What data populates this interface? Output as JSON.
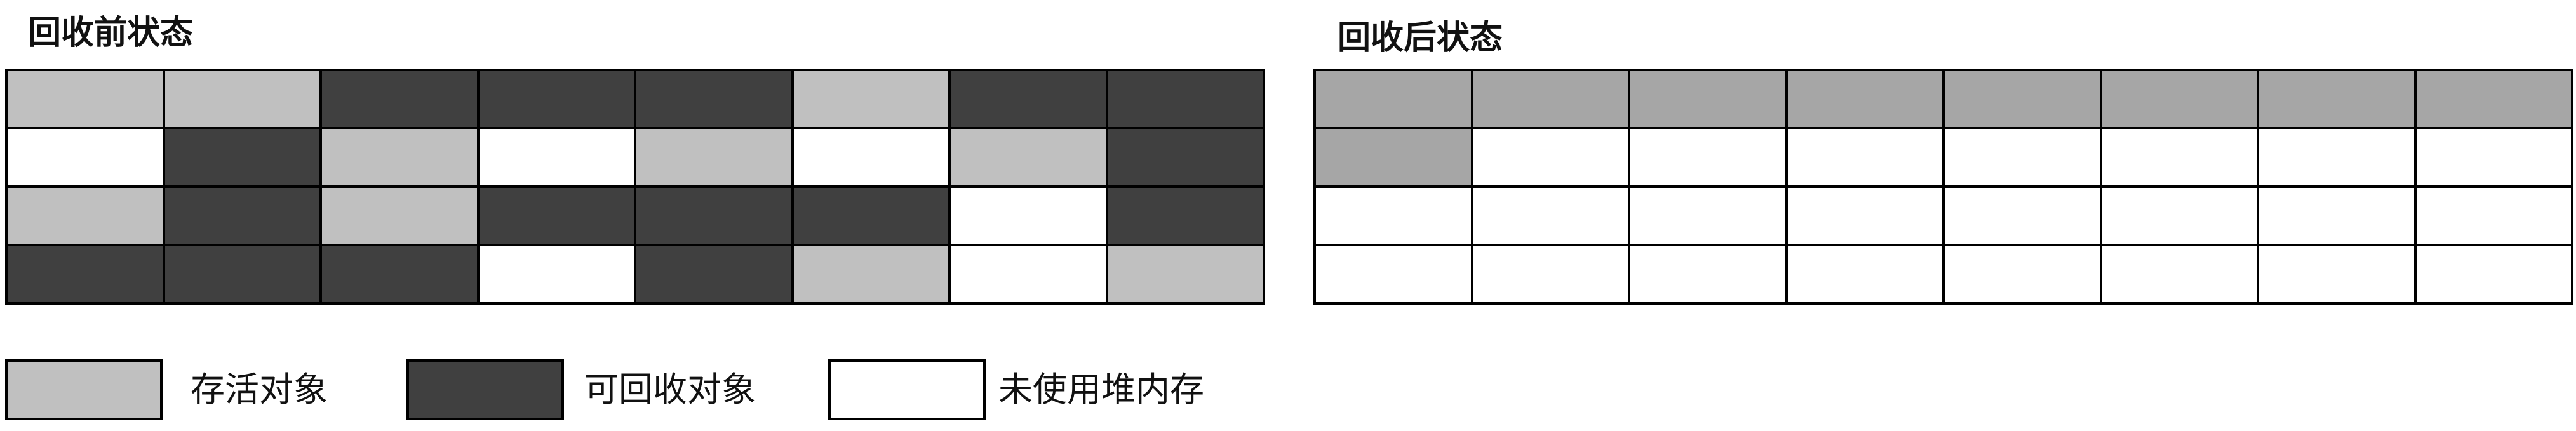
{
  "colors": {
    "live": "#c0c0c0",
    "reclaimable": "#404040",
    "free": "#ffffff",
    "compacted": "#a6a6a6",
    "border": "#000000"
  },
  "before": {
    "title": "回收前状态",
    "rows": [
      [
        "live",
        "live",
        "reclaimable",
        "reclaimable",
        "reclaimable",
        "live",
        "reclaimable",
        "reclaimable"
      ],
      [
        "free",
        "reclaimable",
        "live",
        "free",
        "live",
        "free",
        "live",
        "reclaimable"
      ],
      [
        "live",
        "reclaimable",
        "live",
        "reclaimable",
        "reclaimable",
        "reclaimable",
        "free",
        "reclaimable"
      ],
      [
        "reclaimable",
        "reclaimable",
        "reclaimable",
        "free",
        "reclaimable",
        "live",
        "free",
        "live"
      ]
    ]
  },
  "after": {
    "title": "回收后状态",
    "rows": [
      [
        "compacted",
        "compacted",
        "compacted",
        "compacted",
        "compacted",
        "compacted",
        "compacted",
        "compacted"
      ],
      [
        "compacted",
        "free",
        "free",
        "free",
        "free",
        "free",
        "free",
        "free"
      ],
      [
        "free",
        "free",
        "free",
        "free",
        "free",
        "free",
        "free",
        "free"
      ],
      [
        "free",
        "free",
        "free",
        "free",
        "free",
        "free",
        "free",
        "free"
      ]
    ]
  },
  "legend": {
    "live_label": "存活对象",
    "reclaimable_label": "可回收对象",
    "free_label": "未使用堆内存"
  }
}
